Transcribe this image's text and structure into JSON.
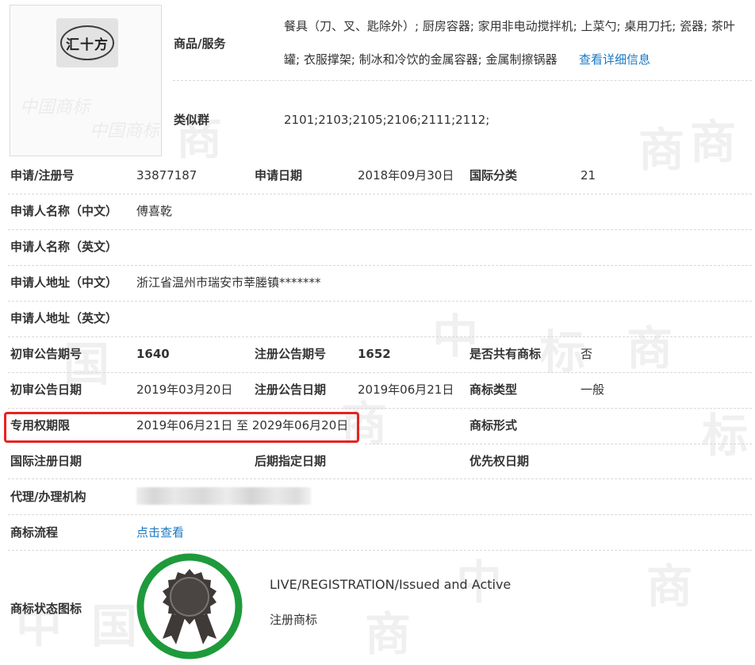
{
  "watermark": {
    "chars": [
      "中",
      "国",
      "商",
      "标"
    ]
  },
  "logo": {
    "text": "汇十方",
    "watermark_text": "中国商标"
  },
  "goods": {
    "label": "商品/服务",
    "line1": "餐具（刀、叉、匙除外）; 厨房容器; 家用非电动搅拌机; 上菜勺; 桌用刀托; 瓷器; 茶叶",
    "line2": "罐; 衣服撑架; 制冰和冷饮的金属容器; 金属制擦锅器",
    "detail_link": "查看详细信息"
  },
  "similar_groups": {
    "label": "类似群",
    "value": "2101;2103;2105;2106;2111;2112;"
  },
  "fields": {
    "reg_no_label": "申请/注册号",
    "reg_no": "33877187",
    "apply_date_label": "申请日期",
    "apply_date": "2018年09月30日",
    "intl_class_label": "国际分类",
    "intl_class": "21",
    "applicant_cn_label": "申请人名称（中文）",
    "applicant_cn": "傅喜乾",
    "applicant_en_label": "申请人名称（英文）",
    "address_cn_label": "申请人地址（中文）",
    "address_cn": "浙江省温州市瑞安市莘塍镇*******",
    "address_en_label": "申请人地址（英文）",
    "prelim_issue_label": "初审公告期号",
    "prelim_issue": "1640",
    "reg_issue_label": "注册公告期号",
    "reg_issue": "1652",
    "shared_label": "是否共有商标",
    "shared": "否",
    "prelim_date_label": "初审公告日期",
    "prelim_date": "2019年03月20日",
    "reg_date_label": "注册公告日期",
    "reg_date": "2019年06月21日",
    "mark_type_label": "商标类型",
    "mark_type": "一般",
    "exclusive_label": "专用权期限",
    "exclusive": "2019年06月21日 至 2029年06月20日",
    "mark_form_label": "商标形式",
    "intl_reg_date_label": "国际注册日期",
    "later_designation_label": "后期指定日期",
    "priority_date_label": "优先权日期",
    "agent_label": "代理/办理机构",
    "process_label": "商标流程",
    "process_link": "点击查看",
    "status_icon_label": "商标状态图标",
    "status_en": "LIVE/REGISTRATION/Issued and Active",
    "status_cn": "注册商标"
  },
  "colors": {
    "link": "#1a78c2",
    "highlight": "#e8231f",
    "status_ring": "#1e9a3b",
    "status_badge": "#3f3a38"
  }
}
